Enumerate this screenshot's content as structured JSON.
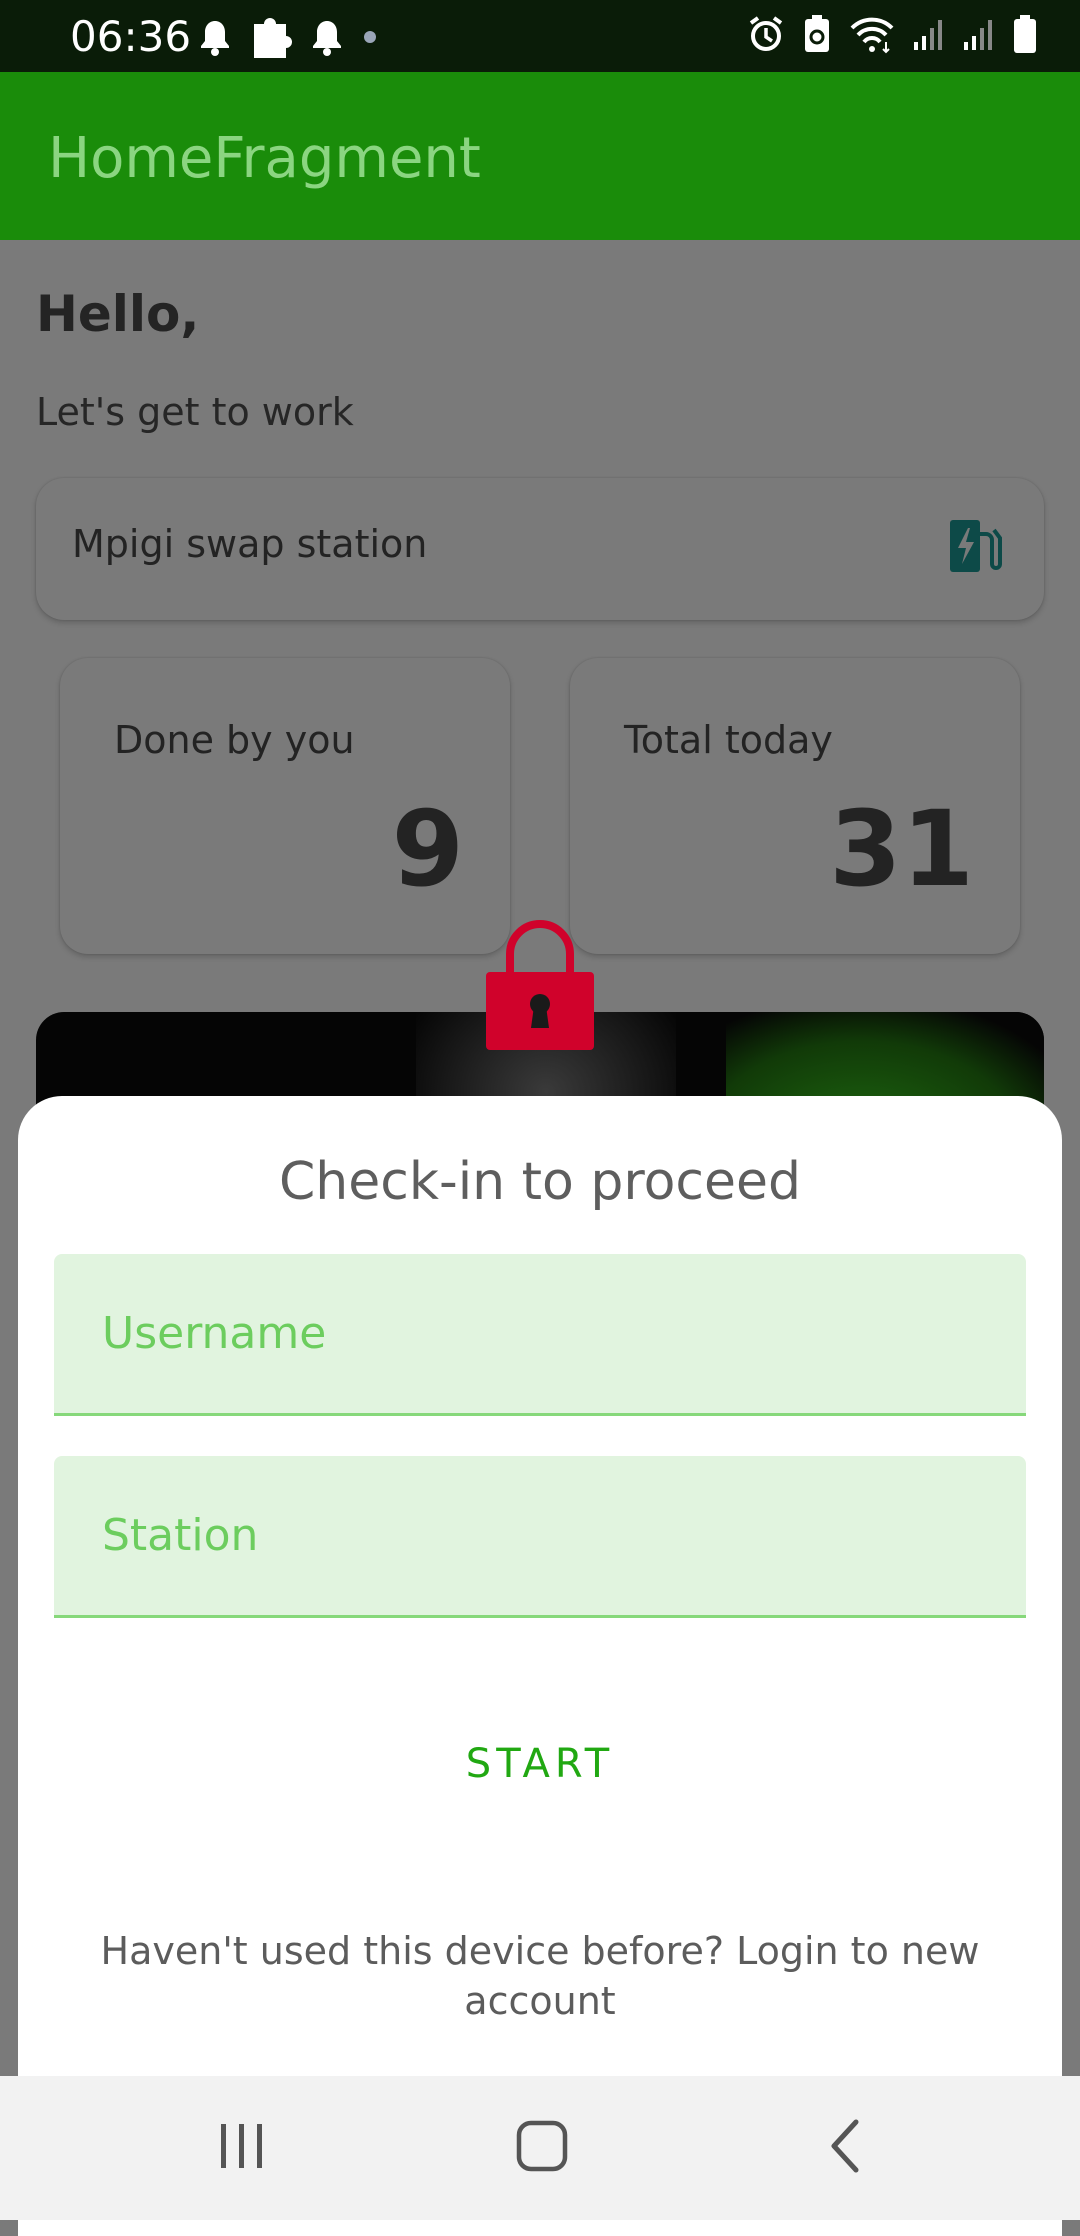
{
  "status_bar": {
    "time": "06:36",
    "left_icons": [
      "notification-bell-icon",
      "puzzle-icon",
      "notification-bell-icon",
      "dot-icon"
    ],
    "right_icons": [
      "alarm-icon",
      "battery-saver-icon",
      "wifi-icon",
      "signal-icon",
      "signal-icon",
      "battery-icon"
    ]
  },
  "app_bar": {
    "title": "HomeFragment",
    "color": "#1a8c0a"
  },
  "home": {
    "greeting": "Hello,",
    "subgreeting": "Let's get to work",
    "station_card": {
      "name": "Mpigi swap station",
      "icon": "ev-station-icon"
    },
    "stats": {
      "done_by_you": {
        "label": "Done by you",
        "value": "9"
      },
      "total_today": {
        "label": "Total today",
        "value": "31"
      }
    }
  },
  "lock_icon": {
    "icon": "lock-icon",
    "color": "#d0022b"
  },
  "checkin_sheet": {
    "title": "Check-in to proceed",
    "username_placeholder": "Username",
    "username_value": "",
    "station_placeholder": "Station",
    "station_value": "",
    "start_label": "START",
    "login_link": "Haven't used this device before? Login to new account",
    "accent_color": "#21a812"
  },
  "nav_bar": {
    "buttons": [
      "recents-icon",
      "home-icon",
      "back-icon"
    ]
  }
}
